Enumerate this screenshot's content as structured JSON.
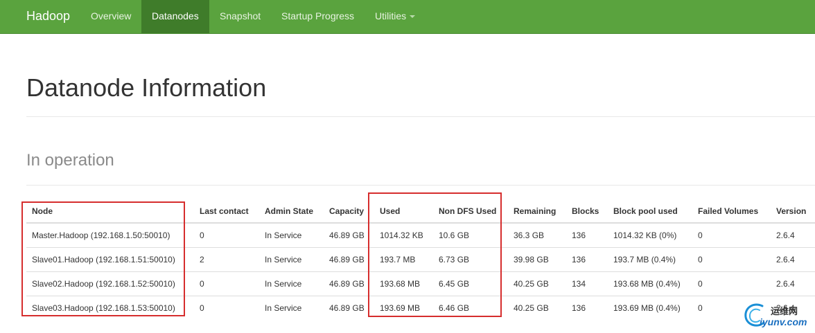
{
  "navbar": {
    "brand": "Hadoop",
    "items": [
      {
        "label": "Overview",
        "active": false
      },
      {
        "label": "Datanodes",
        "active": true
      },
      {
        "label": "Snapshot",
        "active": false
      },
      {
        "label": "Startup Progress",
        "active": false
      },
      {
        "label": "Utilities",
        "active": false,
        "dropdown": true
      }
    ]
  },
  "page": {
    "title": "Datanode Information",
    "section": "In operation"
  },
  "table": {
    "headers": [
      "Node",
      "Last contact",
      "Admin State",
      "Capacity",
      "Used",
      "Non DFS Used",
      "Remaining",
      "Blocks",
      "Block pool used",
      "Failed Volumes",
      "Version"
    ],
    "rows": [
      [
        "Master.Hadoop (192.168.1.50:50010)",
        "0",
        "In Service",
        "46.89 GB",
        "1014.32 KB",
        "10.6 GB",
        "36.3 GB",
        "136",
        "1014.32 KB (0%)",
        "0",
        "2.6.4"
      ],
      [
        "Slave01.Hadoop (192.168.1.51:50010)",
        "2",
        "In Service",
        "46.89 GB",
        "193.7 MB",
        "6.73 GB",
        "39.98 GB",
        "136",
        "193.7 MB (0.4%)",
        "0",
        "2.6.4"
      ],
      [
        "Slave02.Hadoop (192.168.1.52:50010)",
        "0",
        "In Service",
        "46.89 GB",
        "193.68 MB",
        "6.45 GB",
        "40.25 GB",
        "134",
        "193.68 MB (0.4%)",
        "0",
        "2.6.4"
      ],
      [
        "Slave03.Hadoop (192.168.1.53:50010)",
        "0",
        "In Service",
        "46.89 GB",
        "193.69 MB",
        "6.46 GB",
        "40.25 GB",
        "136",
        "193.69 MB (0.4%)",
        "0",
        "2.6.4"
      ]
    ]
  },
  "watermark": {
    "cn": "运维网",
    "url": "iyunv.com"
  },
  "colors": {
    "navbar": "#5aa33e",
    "navbar_active": "#3f7c2a",
    "highlight_box": "#d62d2d"
  }
}
